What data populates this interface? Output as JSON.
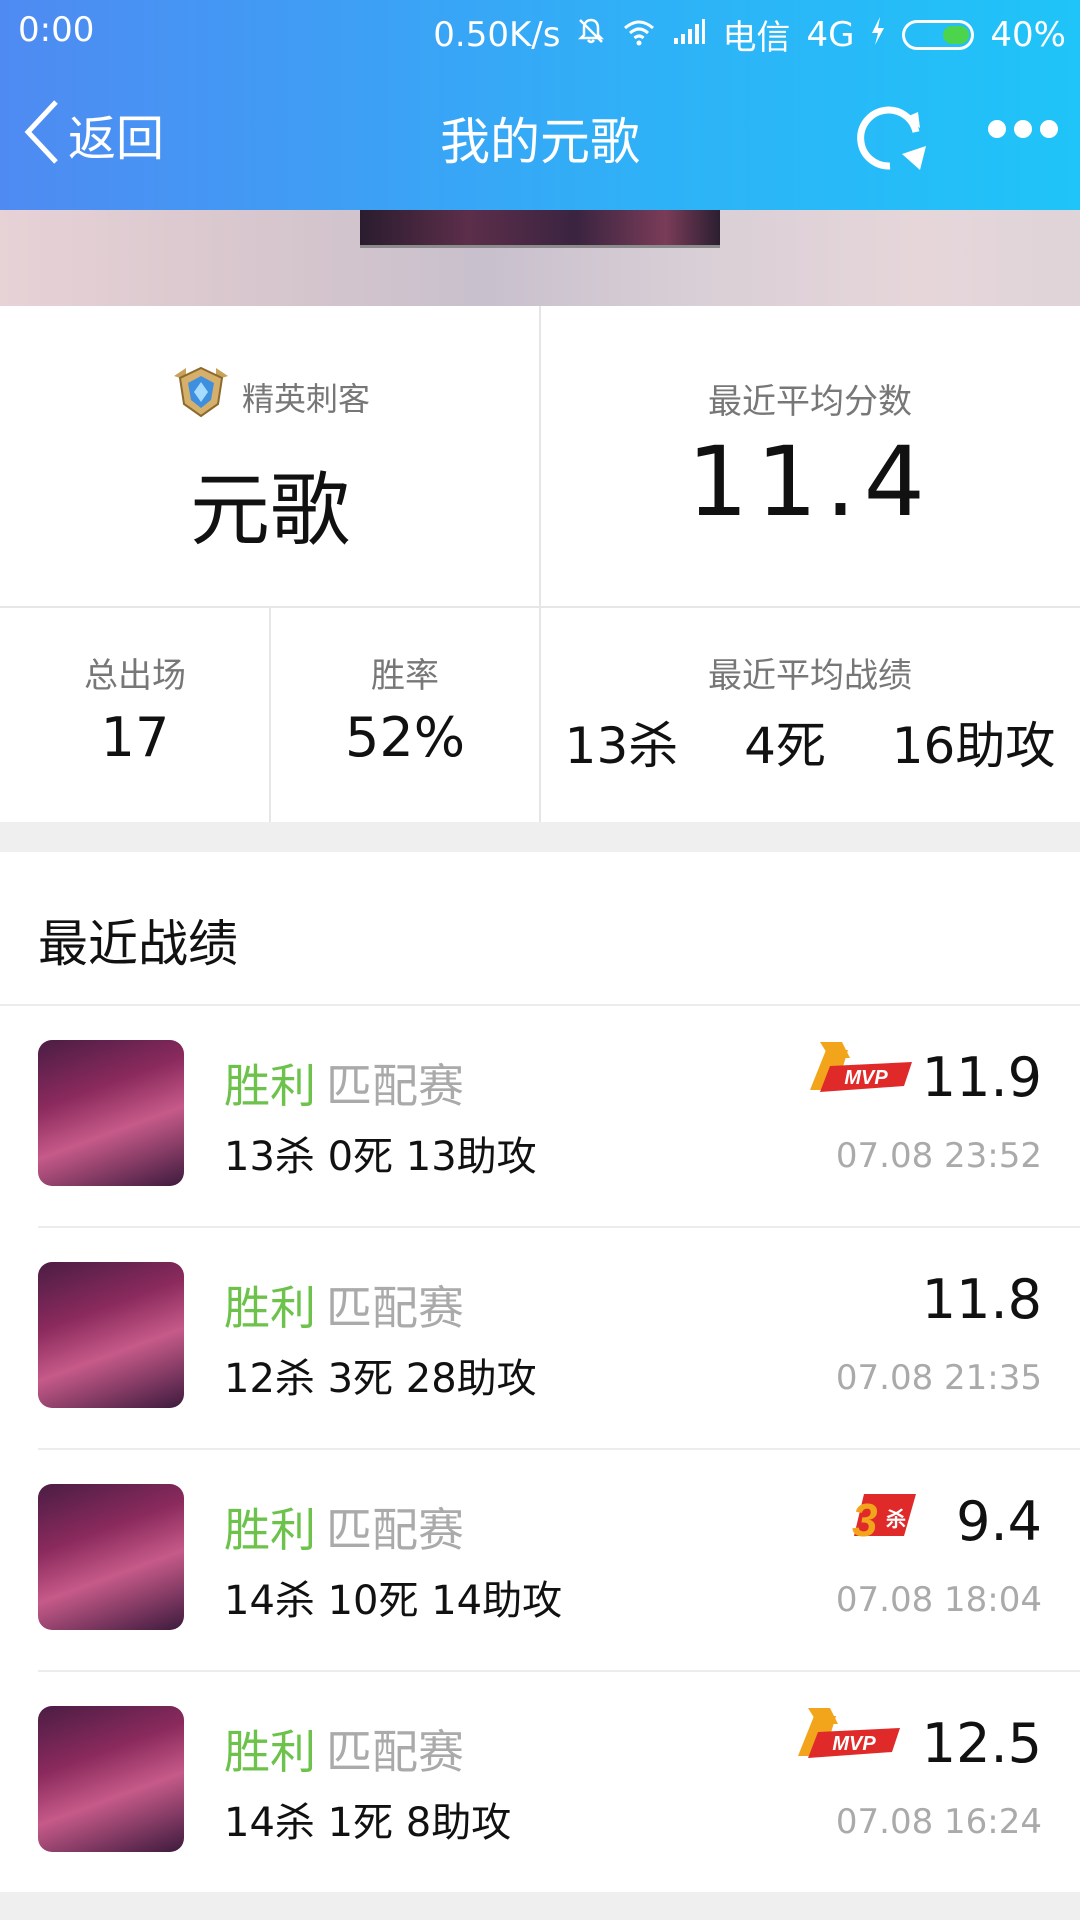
{
  "status_bar": {
    "time": "0:00",
    "network_speed": "0.50K/s",
    "carrier": "电信",
    "network_type": "4G",
    "battery": "40%",
    "icons": [
      "mute-icon",
      "wifi-icon",
      "signal-icon",
      "charging-icon",
      "battery-icon"
    ]
  },
  "nav": {
    "back_label": "返回",
    "title": "我的元歌",
    "icons": [
      "chevron-left-icon",
      "refresh-icon",
      "more-icon"
    ]
  },
  "summary": {
    "rank_label": "精英刺客",
    "hero_name": "元歌",
    "avg_score_label": "最近平均分数",
    "avg_score": "11.4",
    "total_games_label": "总出场",
    "total_games": "17",
    "win_rate_label": "胜率",
    "win_rate": "52%",
    "avg_record_label": "最近平均战绩",
    "avg_kills": "13",
    "avg_kills_unit": "杀",
    "avg_deaths": "4",
    "avg_deaths_unit": "死",
    "avg_assists": "16",
    "avg_assists_unit": "助攻"
  },
  "records": {
    "title": "最近战绩",
    "items": [
      {
        "result": "胜利",
        "mode": "匹配赛",
        "kda": "13杀 0死 13助攻",
        "score": "11.9",
        "time": "07.08 23:52",
        "badge": "MVP",
        "badge_type": "mvp"
      },
      {
        "result": "胜利",
        "mode": "匹配赛",
        "kda": "12杀 3死 28助攻",
        "score": "11.8",
        "time": "07.08 21:35",
        "badge": "",
        "badge_type": "none"
      },
      {
        "result": "胜利",
        "mode": "匹配赛",
        "kda": "14杀 10死 14助攻",
        "score": "9.4",
        "time": "07.08 18:04",
        "badge": "3杀",
        "badge_type": "triple-kill"
      },
      {
        "result": "胜利",
        "mode": "匹配赛",
        "kda": "14杀 1死 8助攻",
        "score": "12.5",
        "time": "07.08 16:24",
        "badge": "MVP",
        "badge_type": "mvp"
      }
    ]
  },
  "colors": {
    "header_start": "#4f8af2",
    "header_end": "#1fc4f8",
    "win_green": "#6cc24a",
    "muted_gray": "#aaaaaa",
    "badge_orange": "#f2a51a",
    "badge_red": "#e02a2a"
  }
}
